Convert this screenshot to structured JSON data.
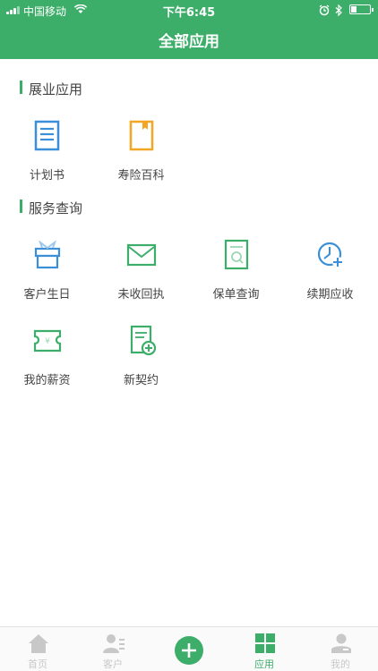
{
  "status_bar": {
    "carrier": "中国移动",
    "time": "下午6:45"
  },
  "header": {
    "title": "全部应用"
  },
  "sections": [
    {
      "title": "展业应用",
      "apps": [
        {
          "label": "计划书",
          "icon": "document-icon"
        },
        {
          "label": "寿险百科",
          "icon": "book-icon"
        }
      ]
    },
    {
      "title": "服务查询",
      "apps": [
        {
          "label": "客户生日",
          "icon": "gift-icon"
        },
        {
          "label": "未收回执",
          "icon": "envelope-icon"
        },
        {
          "label": "保单查询",
          "icon": "policy-search-icon"
        },
        {
          "label": "续期应收",
          "icon": "clock-add-icon"
        },
        {
          "label": "我的薪资",
          "icon": "salary-ticket-icon"
        },
        {
          "label": "新契约",
          "icon": "new-contract-icon"
        }
      ]
    }
  ],
  "tabbar": {
    "items": [
      {
        "label": "首页",
        "icon": "home-icon",
        "active": false
      },
      {
        "label": "客户",
        "icon": "customer-icon",
        "active": false
      },
      {
        "label": "",
        "icon": "plus-icon",
        "active": false
      },
      {
        "label": "应用",
        "icon": "grid-icon",
        "active": true
      },
      {
        "label": "我的",
        "icon": "profile-icon",
        "active": false
      }
    ]
  },
  "colors": {
    "brand": "#3dae6a",
    "blue": "#3b8fd8",
    "orange": "#f2a623",
    "inactive": "#c8c8c8"
  }
}
